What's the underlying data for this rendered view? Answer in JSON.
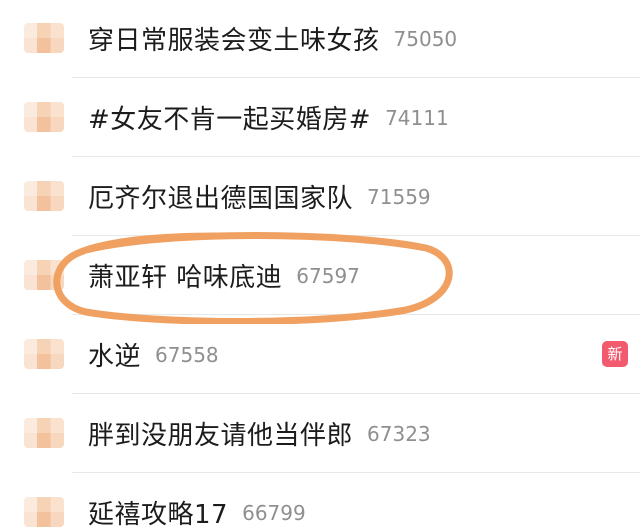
{
  "hot_list": {
    "items": [
      {
        "title": "穿日常服装会变土味女孩",
        "count": "75050"
      },
      {
        "title": "#女友不肯一起买婚房#",
        "count": "74111"
      },
      {
        "title": "厄齐尔退出德国国家队",
        "count": "71559"
      },
      {
        "title": "萧亚轩 哈味底迪",
        "count": "67597"
      },
      {
        "title": "水逆",
        "count": "67558",
        "badge": "新"
      },
      {
        "title": "胖到没朋友请他当伴郎",
        "count": "67323"
      },
      {
        "title": "延禧攻略17",
        "count": "66799"
      }
    ],
    "highlighted_item": "萧亚轩 哈味底迪"
  },
  "colors": {
    "highlight_ring": "#f0a060",
    "badge_new": "#f25a6f",
    "count_text": "#8f8f8f",
    "topic_text": "#1c1c1c"
  },
  "icons": {
    "rank": "rank-icon"
  }
}
